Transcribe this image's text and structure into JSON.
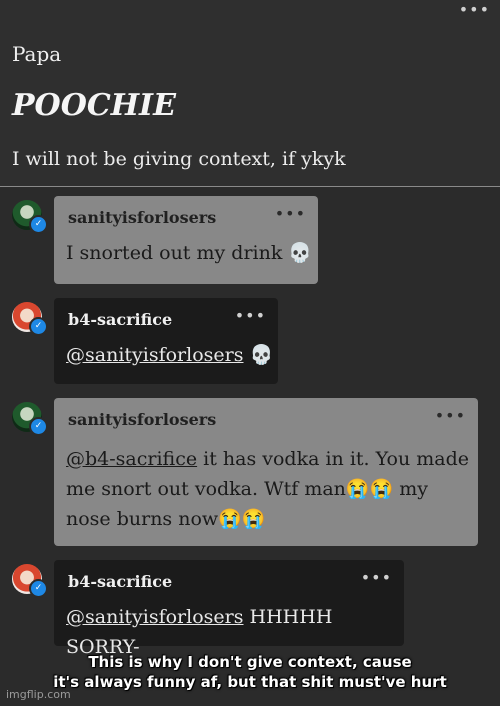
{
  "post": {
    "label": "Papa",
    "title": "POOCHIE",
    "body": "I will not be giving context, if ykyk",
    "menu_icon": "•••"
  },
  "messages": [
    {
      "username": "sanityisforlosers",
      "avatar_icon": "green-avatar",
      "text": "I snorted out my drink 💀",
      "menu": "•••"
    },
    {
      "username": "b4-sacrifice",
      "avatar_icon": "red-avatar",
      "mention": "@sanityisforlosers",
      "text": " 💀",
      "menu": "•••"
    },
    {
      "username": "sanityisforlosers",
      "avatar_icon": "green-avatar",
      "mention": "@b4-sacrifice",
      "line1": " it has vodka in it. You made",
      "line2": "me snort out vodka. Wtf man😭😭 my",
      "line3": "nose burns now😭😭",
      "menu": "•••"
    },
    {
      "username": "b4-sacrifice",
      "avatar_icon": "red-avatar",
      "mention": "@sanityisforlosers",
      "text": " HHHHH SORRY-",
      "menu": "•••"
    }
  ],
  "caption": {
    "line1": "This is why I don't give context, cause",
    "line2": "it's always funny af, but that shit must've hurt"
  },
  "watermark": "imgflip.com",
  "colors": {
    "background": "#2b2b2b",
    "grey_bubble": "#888888",
    "dark_bubble": "#1b1b1b",
    "verified_badge": "#1e88e5"
  }
}
